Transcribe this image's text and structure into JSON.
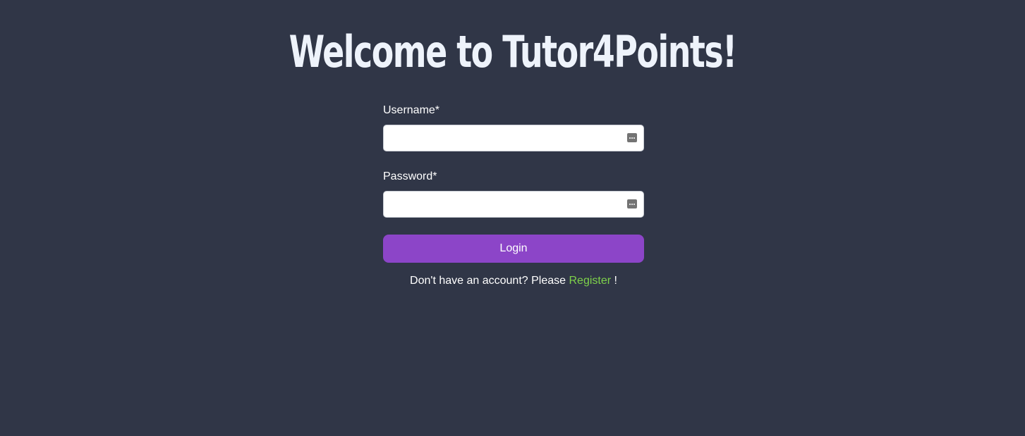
{
  "page": {
    "title": "Welcome to Tutor4Points!"
  },
  "form": {
    "username_label": "Username*",
    "username_value": "",
    "password_label": "Password*",
    "password_value": "",
    "login_label": "Login",
    "register_prefix": "Don't have an account? Please ",
    "register_link": "Register",
    "register_suffix": " !"
  },
  "icons": {
    "username_field_icon": "password-manager-icon",
    "password_field_icon": "password-manager-icon"
  },
  "colors": {
    "background": "#303647",
    "title": "#eef3fb",
    "button": "#8c45c8",
    "link": "#7ed24a"
  }
}
